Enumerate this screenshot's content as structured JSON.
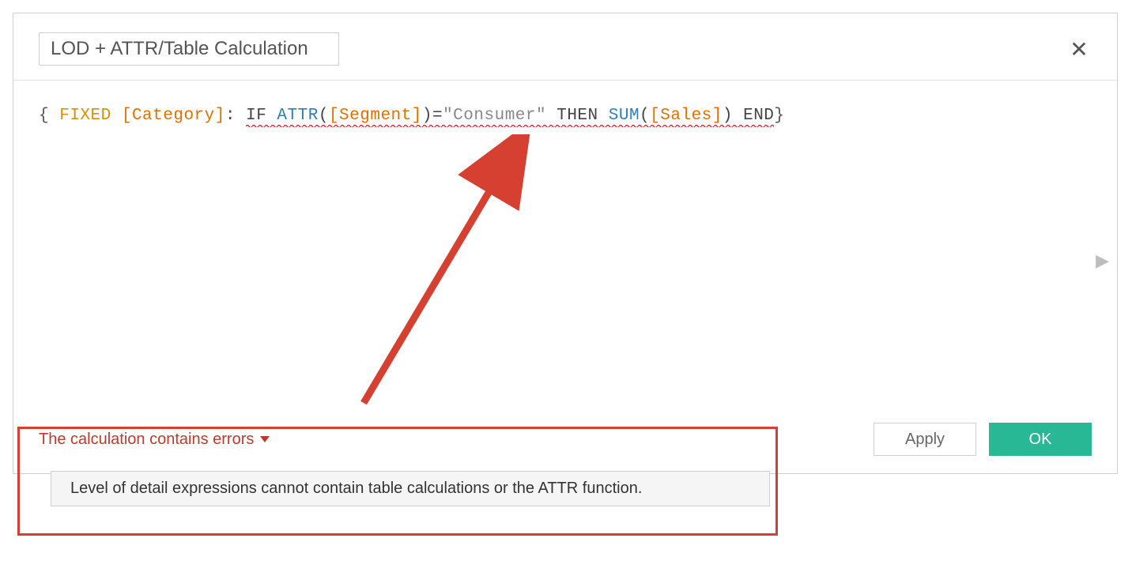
{
  "dialog": {
    "name_value": "LOD + ATTR/Table Calculation",
    "formula": {
      "open_brace": "{ ",
      "fixed_kw": "FIXED ",
      "field_category": "[Category]",
      "colon": ": ",
      "if_kw": "IF ",
      "attr_fn": "ATTR",
      "lparen1": "(",
      "field_segment": "[Segment]",
      "rparen1": ")",
      "eq": "=",
      "lit_consumer": "\"Consumer\"",
      "then_kw": " THEN ",
      "sum_fn": "SUM",
      "lparen2": "(",
      "field_sales": "[Sales]",
      "rparen2": ")",
      "end_kw": " END",
      "close_brace": "}"
    },
    "error_summary": "The calculation contains errors",
    "error_detail": "Level of detail expressions cannot contain table calculations or the ATTR function.",
    "apply_label": "Apply",
    "ok_label": "OK"
  }
}
